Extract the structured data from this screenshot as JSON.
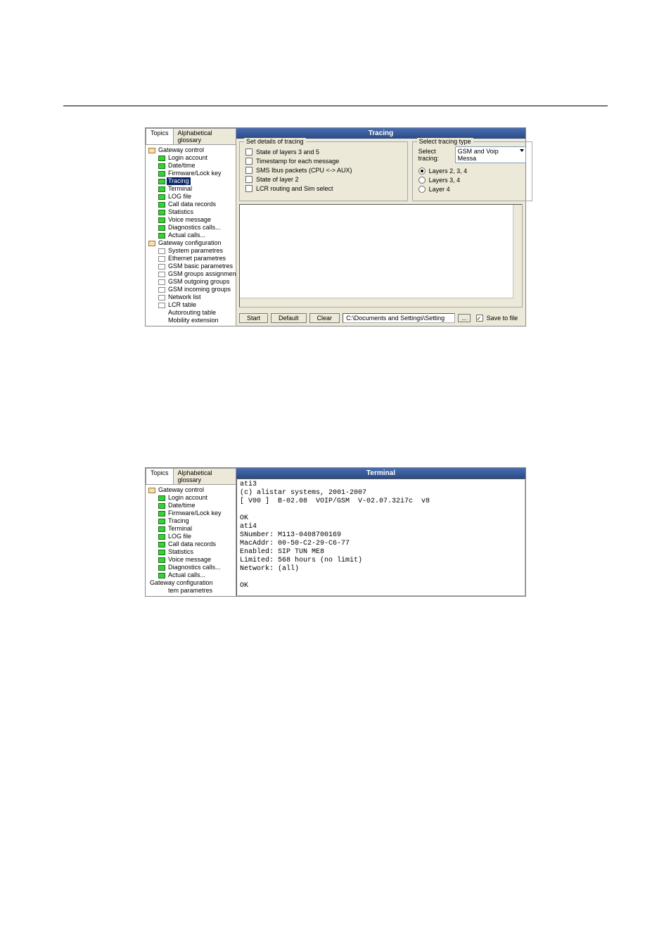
{
  "tabs": {
    "topics": "Topics",
    "alpha": "Alphabetical glossary"
  },
  "tree1": [
    {
      "label": "Gateway control",
      "indent": 0,
      "icon": "folder"
    },
    {
      "label": "Login account",
      "indent": 1,
      "icon": "green"
    },
    {
      "label": "Date/time",
      "indent": 1,
      "icon": "green"
    },
    {
      "label": "Firmware/Lock key",
      "indent": 1,
      "icon": "green"
    },
    {
      "label": "Tracing",
      "indent": 1,
      "icon": "green",
      "selected": true
    },
    {
      "label": "Terminal",
      "indent": 1,
      "icon": "green"
    },
    {
      "label": "LOG file",
      "indent": 1,
      "icon": "green"
    },
    {
      "label": "Call data records",
      "indent": 1,
      "icon": "green"
    },
    {
      "label": "Statistics",
      "indent": 1,
      "icon": "green"
    },
    {
      "label": "Voice message",
      "indent": 1,
      "icon": "green"
    },
    {
      "label": "Diagnostics calls...",
      "indent": 1,
      "icon": "green"
    },
    {
      "label": "Actual calls...",
      "indent": 1,
      "icon": "green"
    },
    {
      "label": "Gateway configuration",
      "indent": 0,
      "icon": "folder"
    },
    {
      "label": "System parametres",
      "indent": 1,
      "icon": "doc"
    },
    {
      "label": "Ethernet parametres",
      "indent": 1,
      "icon": "doc"
    },
    {
      "label": "GSM basic parametres",
      "indent": 1,
      "icon": "doc"
    },
    {
      "label": "GSM groups assignment",
      "indent": 1,
      "icon": "doc"
    },
    {
      "label": "GSM outgoing groups",
      "indent": 1,
      "icon": "doc"
    },
    {
      "label": "GSM incoming groups",
      "indent": 1,
      "icon": "doc"
    },
    {
      "label": "Network list",
      "indent": 1,
      "icon": "doc"
    },
    {
      "label": "LCR table",
      "indent": 1,
      "icon": "doc"
    },
    {
      "label": "Autorouting table",
      "indent": 2,
      "icon": ""
    },
    {
      "label": "Mobility extension",
      "indent": 2,
      "icon": ""
    }
  ],
  "tree2": [
    {
      "label": "Gateway control",
      "indent": 0,
      "icon": "folder"
    },
    {
      "label": "Login account",
      "indent": 1,
      "icon": "green"
    },
    {
      "label": "Date/time",
      "indent": 1,
      "icon": "green"
    },
    {
      "label": "Firmware/Lock key",
      "indent": 1,
      "icon": "green"
    },
    {
      "label": "Tracing",
      "indent": 1,
      "icon": "green"
    },
    {
      "label": "Terminal",
      "indent": 1,
      "icon": "green"
    },
    {
      "label": "LOG file",
      "indent": 1,
      "icon": "green"
    },
    {
      "label": "Call data records",
      "indent": 1,
      "icon": "green"
    },
    {
      "label": "Statistics",
      "indent": 1,
      "icon": "green"
    },
    {
      "label": "Voice message",
      "indent": 1,
      "icon": "green"
    },
    {
      "label": "Diagnostics calls...",
      "indent": 1,
      "icon": "green"
    },
    {
      "label": "Actual calls...",
      "indent": 1,
      "icon": "green"
    },
    {
      "label": "Gateway configuration",
      "indent": 0,
      "icon": ""
    },
    {
      "label": "tem parametres",
      "indent": 2,
      "icon": ""
    }
  ],
  "tracing": {
    "title": "Tracing",
    "details_group": "Set details of tracing",
    "chk1": "State of layers 3 and 5",
    "chk2": "Timestamp for each message",
    "chk3": "SMS Ibus packets (CPU <-> AUX)",
    "chk4": "State of layer 2",
    "chk5": "LCR routing and Sim select",
    "type_group": "Select tracing type",
    "select_label": "Select tracing:",
    "select_value": "GSM and Voip Messa",
    "radio1": "Layers 2, 3, 4",
    "radio2": "Layers 3, 4",
    "radio3": "Layer 4"
  },
  "bottom": {
    "start": "Start",
    "default": "Default",
    "clear": "Clear",
    "path": "C:\\Documents and Settings\\Setting",
    "browse": "...",
    "save": "Save to file"
  },
  "terminal": {
    "title": "Terminal",
    "lines": "ati3\n(c) alistar systems, 2001-2007\n[ V00 ]  B-02.08  VOIP/GSM  V-02.07.32i7c  v8\n\nOK\nati4\nSNumber: M113-0408700169\nMacAddr: 00-50-C2-29-C6-77\nEnabled: SIP TUN ME8\nLimited: 568 hours (no limit)\nNetwork: (all)\n\nOK"
  }
}
